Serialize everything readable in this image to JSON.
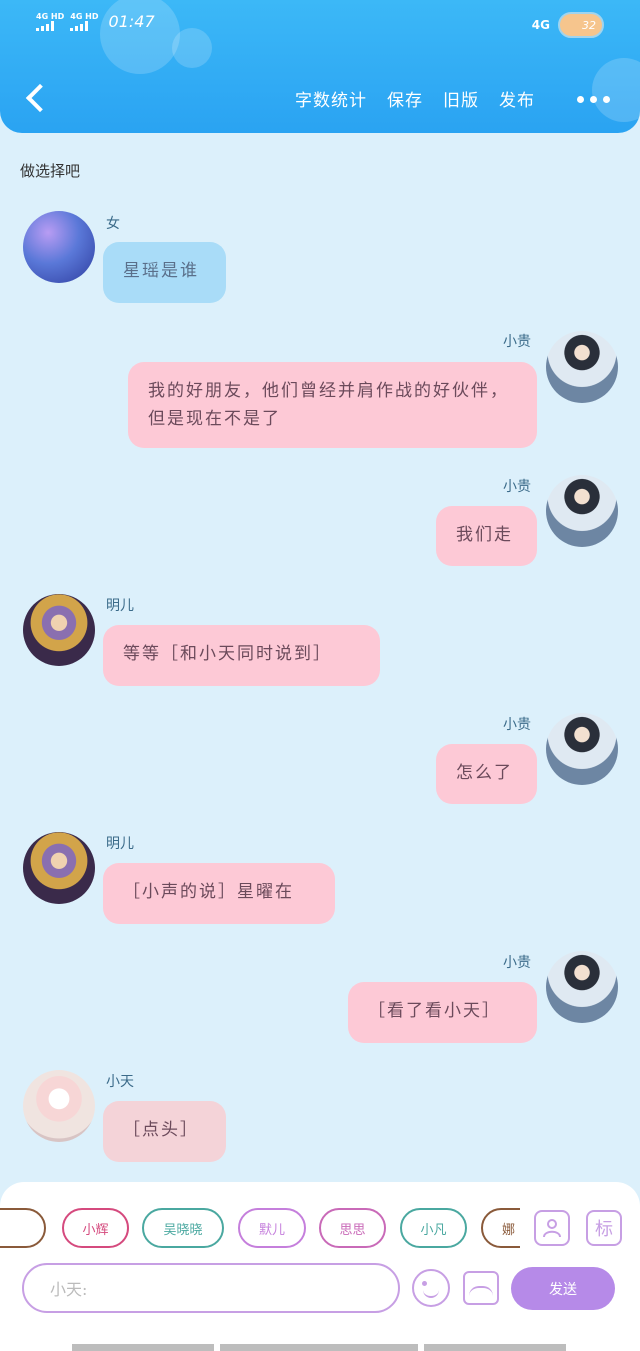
{
  "status": {
    "signal1": "4G HD",
    "signal2": "4G HD",
    "time": "01:47",
    "network": "4G",
    "battery": "32"
  },
  "topbar": {
    "nav": [
      "字数统计",
      "保存",
      "旧版",
      "发布"
    ]
  },
  "intro": "做选择吧",
  "messages": [
    {
      "name": "女",
      "text": "星瑶是谁"
    },
    {
      "name": "小贵",
      "text": "我的好朋友，他们曾经并肩作战的好伙伴，但是现在不是了"
    },
    {
      "name": "小贵",
      "text": "我们走"
    },
    {
      "name": "明儿",
      "text": "等等［和小天同时说到］"
    },
    {
      "name": "小贵",
      "text": "怎么了"
    },
    {
      "name": "明儿",
      "text": "［小声的说］星曜在"
    },
    {
      "name": "小贵",
      "text": "［看了看小天］"
    },
    {
      "name": "小天",
      "text": "［点头］"
    }
  ],
  "chips": [
    "",
    "小辉",
    "吴晓晓",
    "默儿",
    "思思",
    "小凡",
    "娜"
  ],
  "chip_colors": [
    "#8a5a3a",
    "#d54a7e",
    "#4aa8a0",
    "#c57fdc",
    "#c96ab8",
    "#4aa8a0",
    "#8a5a3a"
  ],
  "tools": {
    "person_icon": "person-icon",
    "tag_label": "标"
  },
  "input": {
    "placeholder": "小天:"
  },
  "send_label": "发送"
}
